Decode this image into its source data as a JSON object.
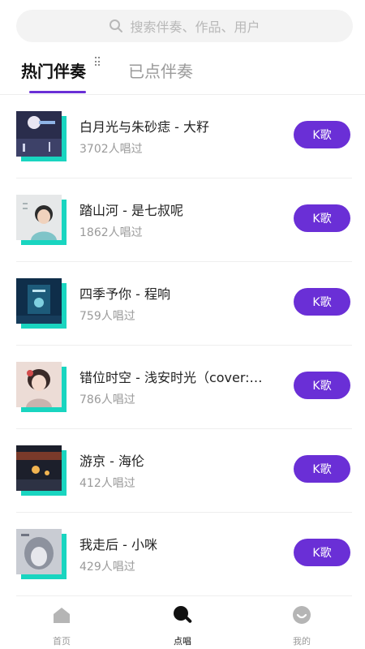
{
  "search": {
    "placeholder": "搜索伴奏、作品、用户",
    "icon": "search-icon"
  },
  "tabs": [
    {
      "label": "热门伴奏",
      "active": true
    },
    {
      "label": "已点伴奏",
      "active": false
    }
  ],
  "songs": [
    {
      "title": "白月光与朱砂痣 - 大籽",
      "count": "3702人唱过",
      "button": "K歌"
    },
    {
      "title": "踏山河 - 是七叔呢",
      "count": "1862人唱过",
      "button": "K歌"
    },
    {
      "title": "四季予你 - 程响",
      "count": "759人唱过",
      "button": "K歌"
    },
    {
      "title": "错位时空 - 浅安时光（cover:…",
      "count": "786人唱过",
      "button": "K歌"
    },
    {
      "title": "游京 - 海伦",
      "count": "412人唱过",
      "button": "K歌"
    },
    {
      "title": "我走后 - 小咪",
      "count": "429人唱过",
      "button": "K歌"
    }
  ],
  "bottom_nav": [
    {
      "label": "首页",
      "icon": "home-icon",
      "active": false
    },
    {
      "label": "点唱",
      "icon": "microphone-icon",
      "active": true
    },
    {
      "label": "我的",
      "icon": "smile-icon",
      "active": false
    }
  ],
  "colors": {
    "accent": "#6a2fd6",
    "cover_shadow": "#19d5c0",
    "muted_text": "#9a9a9a"
  }
}
